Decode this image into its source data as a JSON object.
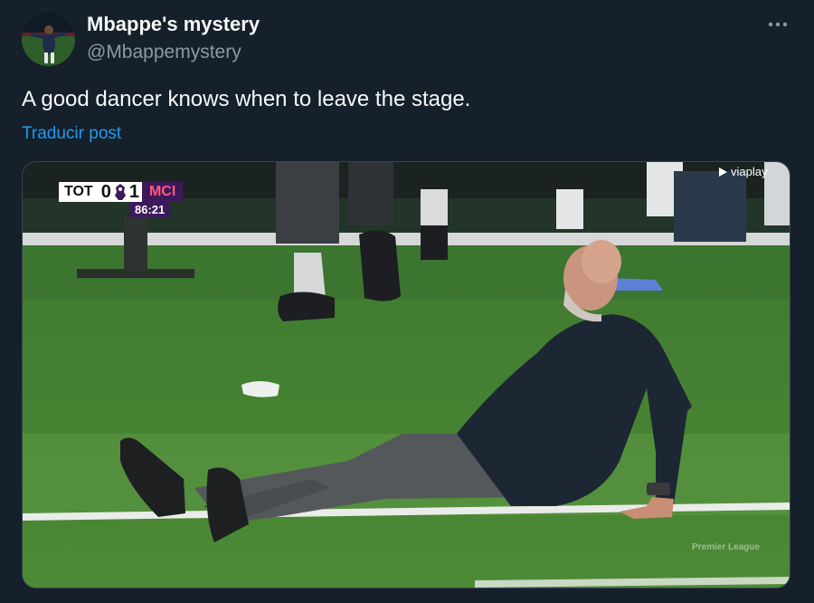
{
  "author": {
    "name": "Mbappe's mystery",
    "handle": "@Mbappemystery"
  },
  "tweet": {
    "text": "A good dancer knows when to leave the stage.",
    "translate_label": "Traducir post"
  },
  "media": {
    "scoreboard": {
      "home_team": "TOT",
      "home_score": "0",
      "away_score": "1",
      "away_team": "MCI",
      "clock": "86:21"
    },
    "broadcaster": "viaplay",
    "watermark": "Premier League"
  },
  "icons": {
    "more": "more-horizontal-icon",
    "broadcaster_logo": "play-arrow-icon",
    "league_logo": "premier-league-lion-icon"
  },
  "colors": {
    "background": "#15202b",
    "primary_text": "#f7f9f9",
    "secondary_text": "#8b98a5",
    "link": "#1d9bf0"
  }
}
